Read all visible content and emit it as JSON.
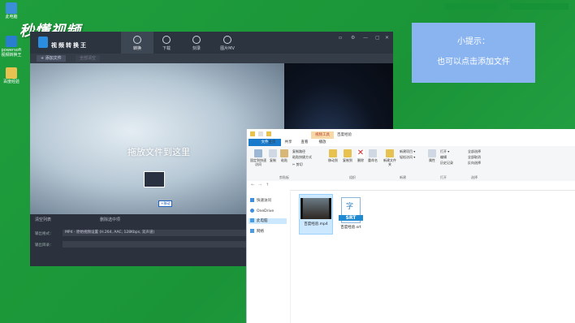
{
  "desktop": {
    "icons": [
      {
        "label": "此电脑",
        "icon": "computer-icon"
      },
      {
        "label": "powersoft 视频转换王",
        "icon": "converter-shortcut-icon"
      },
      {
        "label": "百度经验",
        "icon": "folder-icon"
      }
    ],
    "watermark": "秒懂视频"
  },
  "tip": {
    "title": "小提示：",
    "body": "也可以点击添加文件"
  },
  "converter": {
    "app_name": "视频转换王",
    "tabs": [
      {
        "label": "转换",
        "icon": "refresh-icon"
      },
      {
        "label": "下载",
        "icon": "download-icon"
      },
      {
        "label": "刻录",
        "icon": "disc-icon"
      },
      {
        "label": "图片MV",
        "icon": "photo-icon"
      }
    ],
    "toolbar": {
      "add_file": "+ 添加文件",
      "disabled_btn": "全部清空"
    },
    "drop_hint": "拖放文件到这里",
    "move_badge": "+移动",
    "bottom": {
      "clear_list": "清空列表",
      "remove_selected": "删除选中项",
      "output_format_label": "输出格式：",
      "output_format_value": "MP4 - 原始视频设置 (H.264, AAC, 128Kbps, 双声道)",
      "output_dir_label": "输出目录："
    }
  },
  "explorer": {
    "context_tab": "视频工具",
    "title": "百度经验",
    "ribbon_tabs": [
      "文件",
      "主页",
      "共享",
      "查看",
      "播放"
    ],
    "ribbon": {
      "buttons": [
        {
          "label": "固定到快速访问",
          "icon": "pin-icon"
        },
        {
          "label": "复制",
          "icon": "copy-icon"
        },
        {
          "label": "粘贴",
          "icon": "paste-icon"
        },
        {
          "label": "移动到",
          "icon": "move-to-icon"
        },
        {
          "label": "复制到",
          "icon": "copy-to-icon"
        },
        {
          "label": "删除",
          "icon": "delete-icon"
        },
        {
          "label": "重命名",
          "icon": "rename-icon"
        },
        {
          "label": "新建文件夹",
          "icon": "new-folder-icon"
        },
        {
          "label": "属性",
          "icon": "properties-icon"
        }
      ],
      "small": {
        "cut": "✂ 剪切",
        "copy_path": "复制路径",
        "paste_shortcut": "粘贴快捷方式",
        "new_item": "新建项目 ▾",
        "easy_access": "轻松访问 ▾",
        "open": "打开 ▾",
        "edit": "编辑",
        "history": "历史记录",
        "select_all": "全部选择",
        "select_none": "全部取消",
        "invert": "反向选择"
      },
      "groups": [
        "剪贴板",
        "组织",
        "新建",
        "打开",
        "选择"
      ]
    },
    "nav": [
      {
        "label": "快速访问",
        "icon": "star-icon"
      },
      {
        "label": "OneDrive",
        "icon": "cloud-icon"
      },
      {
        "label": "此电脑",
        "icon": "computer-icon"
      },
      {
        "label": "网络",
        "icon": "network-icon"
      }
    ],
    "files": [
      {
        "name": "百度经验.mp4",
        "type": "video"
      },
      {
        "name": "百度经验.srt",
        "type": "subtitle",
        "badge": "SRT",
        "glyph": "字"
      }
    ]
  }
}
